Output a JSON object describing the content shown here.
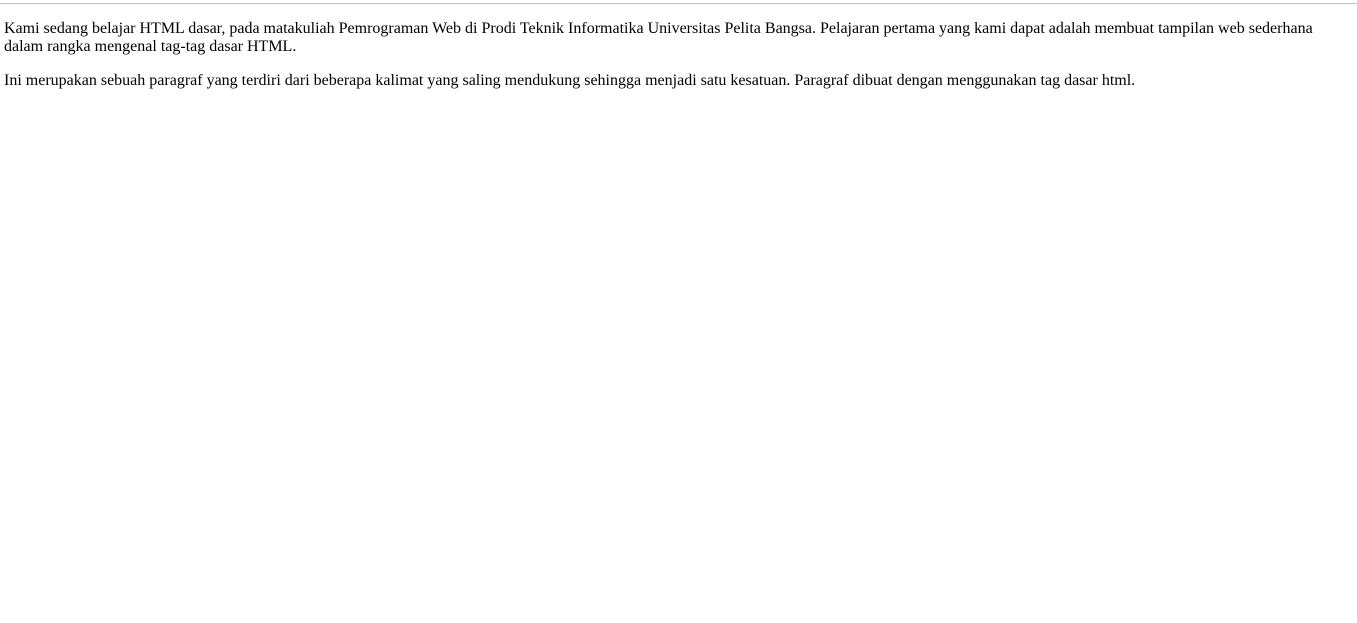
{
  "page": {
    "paragraphs": [
      "Kami sedang belajar HTML dasar, pada matakuliah Pemrograman Web di Prodi Teknik Informatika Universitas Pelita Bangsa. Pelajaran pertama yang kami dapat adalah membuat tampilan web sederhana dalam rangka mengenal tag-tag dasar HTML.",
      "Ini merupakan sebuah paragraf yang terdiri dari beberapa kalimat yang saling mendukung sehingga menjadi satu kesatuan. Paragraf dibuat dengan menggunakan tag dasar html."
    ]
  },
  "colors": {
    "background": "#ffffff",
    "text": "#000000",
    "rule": "#c0c0c0"
  }
}
